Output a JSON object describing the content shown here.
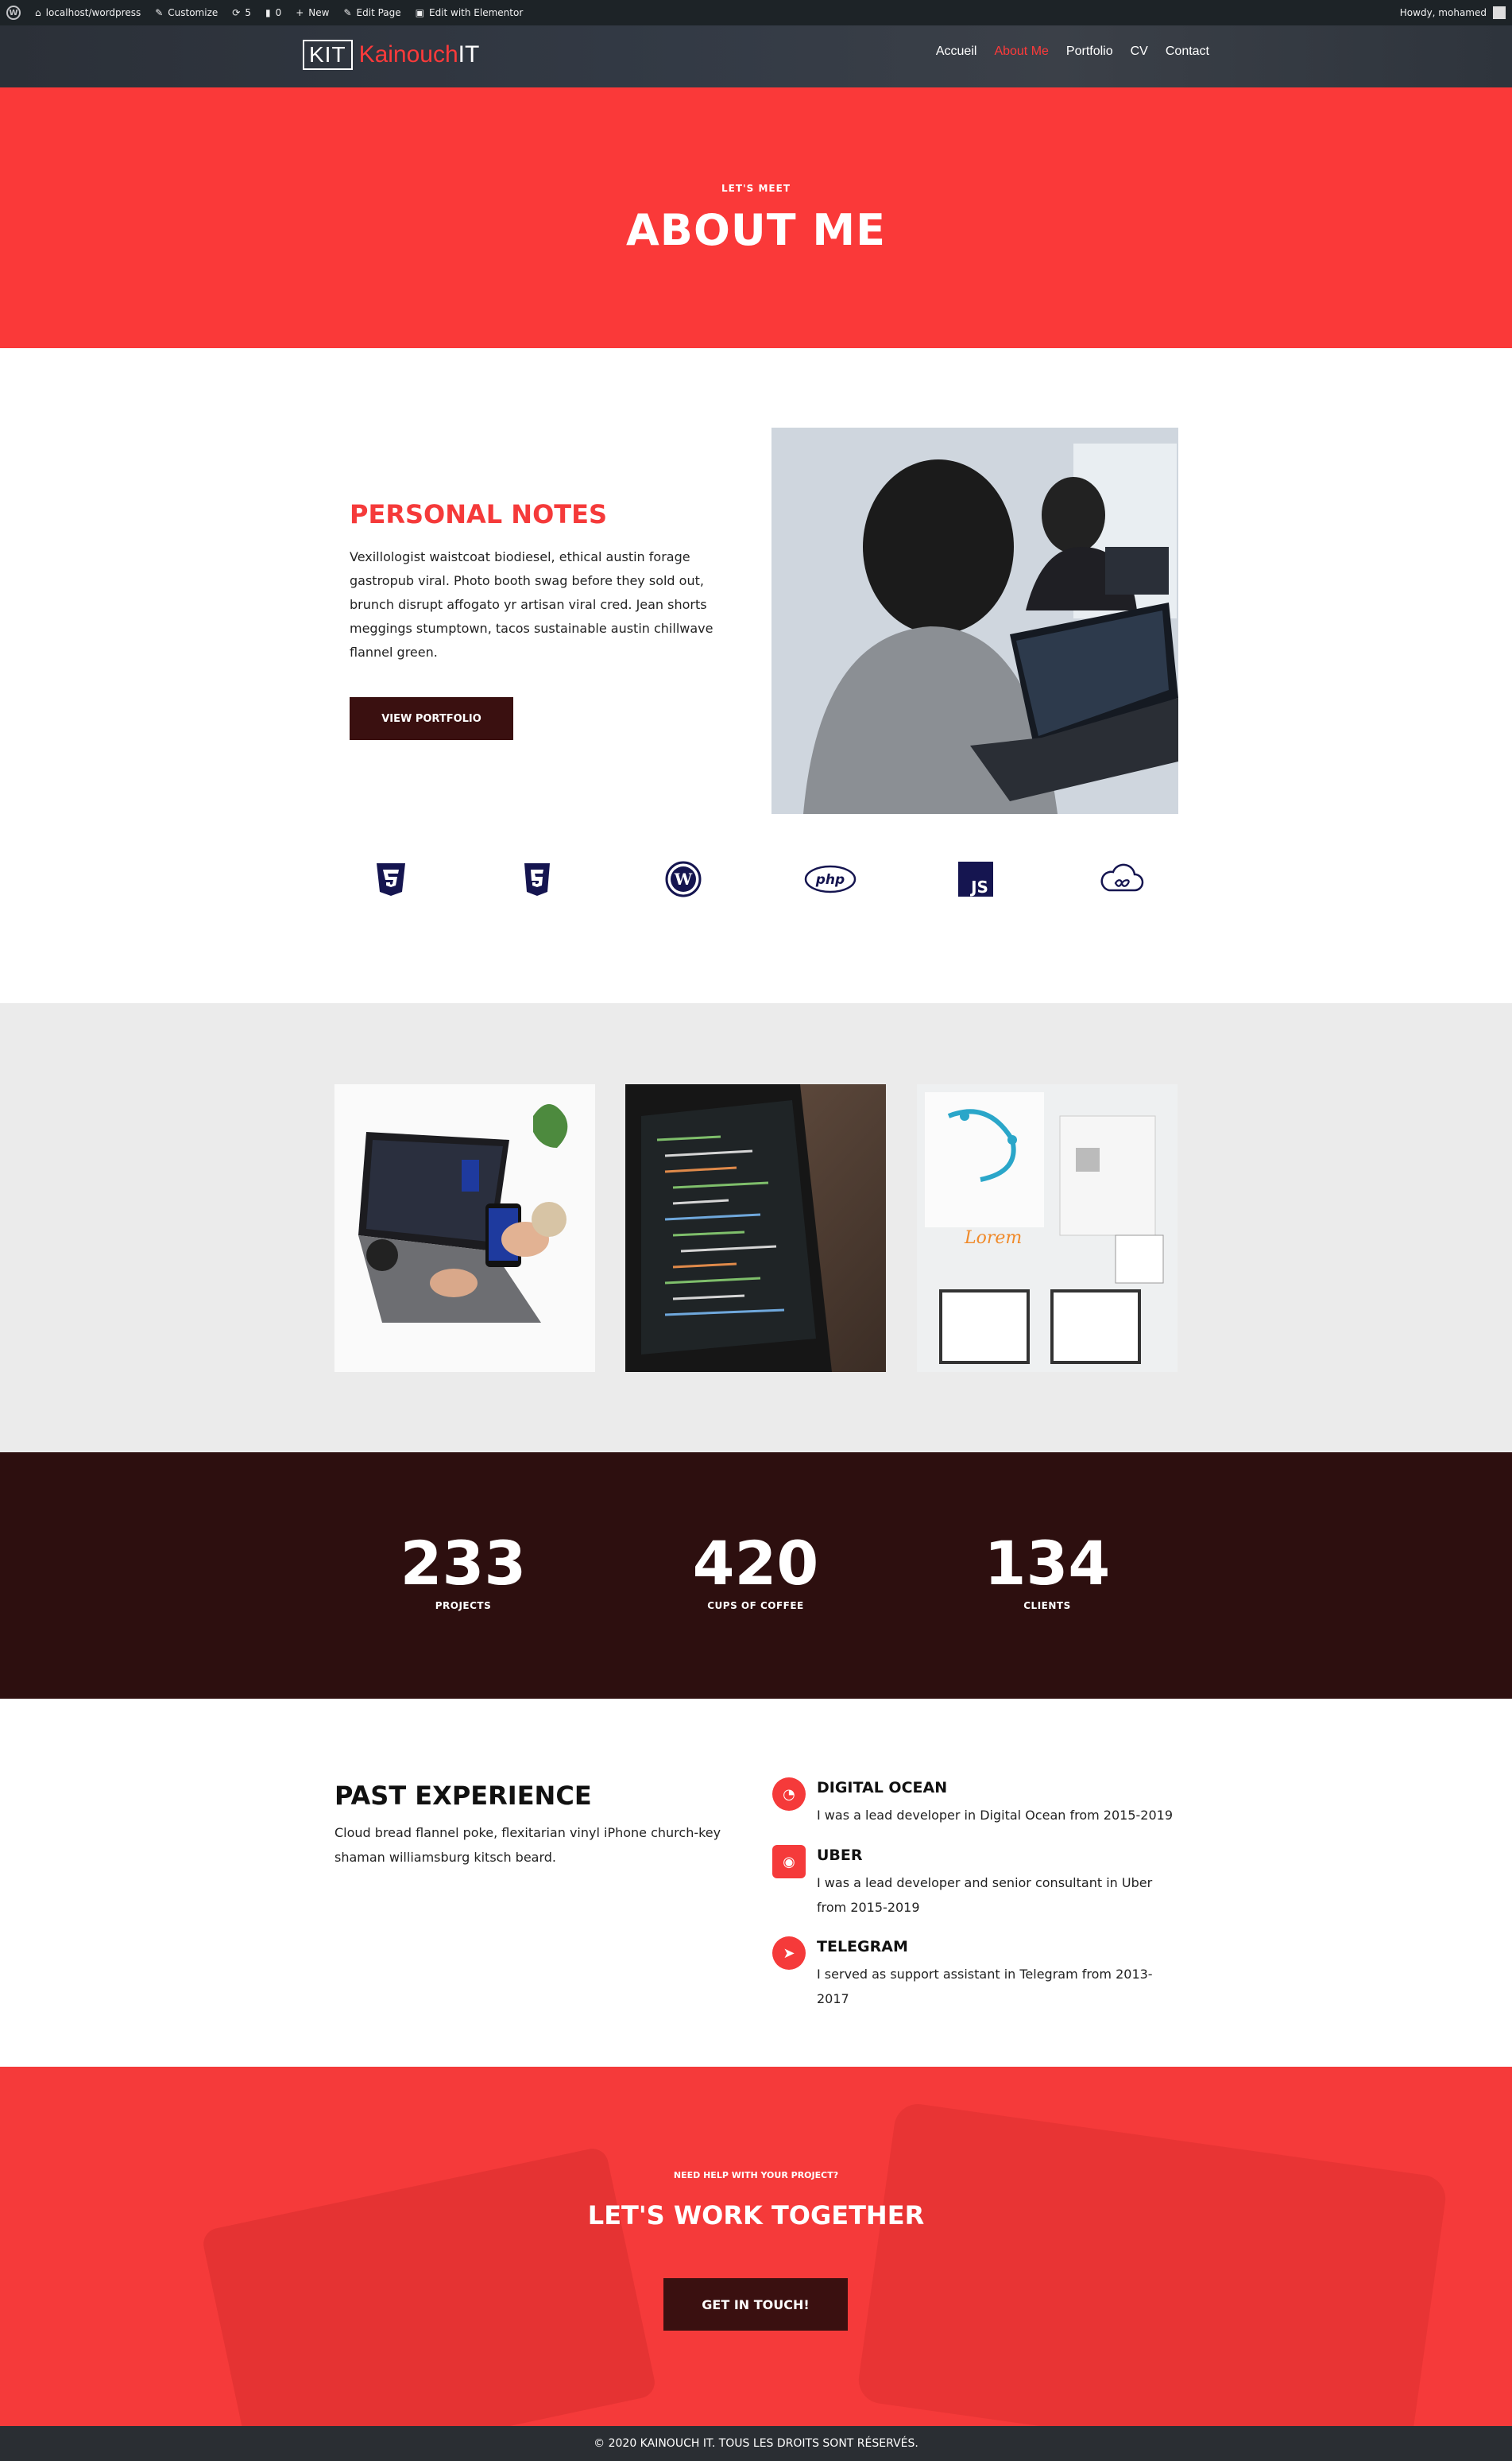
{
  "adminbar": {
    "site": "localhost/wordpress",
    "customize": "Customize",
    "updates": "5",
    "comments": "0",
    "new": "New",
    "edit_page": "Edit Page",
    "edit_elementor": "Edit with Elementor",
    "howdy": "Howdy, mohamed"
  },
  "header": {
    "logo_box": "KIT",
    "logo_name_a": "Kainouch",
    "logo_name_b": "IT",
    "nav": [
      "Accueil",
      "About Me",
      "Portfolio",
      "CV",
      "Contact"
    ],
    "active_index": 1
  },
  "hero": {
    "kicker": "LET'S MEET",
    "title": "ABOUT ME"
  },
  "notes": {
    "title": "PERSONAL NOTES",
    "text": "Vexillologist waistcoat biodiesel, ethical austin forage gastropub viral. Photo booth swag before they sold out, brunch disrupt affogato yr artisan viral cred. Jean shorts meggings stumptown, tacos sustainable austin chillwave flannel green.",
    "button": "VIEW PORTFOLIO"
  },
  "tech_icons": [
    "css3-icon",
    "html5-icon",
    "wordpress-icon",
    "php-icon",
    "javascript-icon",
    "cloud-icon"
  ],
  "stats": [
    {
      "value": "233",
      "label": "PROJECTS"
    },
    {
      "value": "420",
      "label": "CUPS OF COFFEE"
    },
    {
      "value": "134",
      "label": "CLIENTS"
    }
  ],
  "experience": {
    "title": "PAST EXPERIENCE",
    "text": "Cloud bread flannel poke, flexitarian vinyl iPhone church-key shaman williamsburg kitsch beard.",
    "items": [
      {
        "title": "DIGITAL OCEAN",
        "desc": "I was a lead developer in Digital Ocean from 2015-2019"
      },
      {
        "title": "UBER",
        "desc": "I was a lead developer and senior consultant in Uber from 2015-2019"
      },
      {
        "title": "TELEGRAM",
        "desc": "I served as support assistant in Telegram from 2013-2017"
      }
    ]
  },
  "cta": {
    "kicker": "NEED HELP WITH YOUR PROJECT?",
    "title": "LET'S WORK TOGETHER",
    "button": "GET IN TOUCH!"
  },
  "footer": {
    "text": "© 2020 KAINOUCH IT. TOUS LES DROITS SONT RÉSERVÉS."
  },
  "colors": {
    "accent": "#fa3939",
    "dark": "#2d0f0f",
    "button": "#3a1010",
    "gallery_bg": "#ebebeb"
  }
}
